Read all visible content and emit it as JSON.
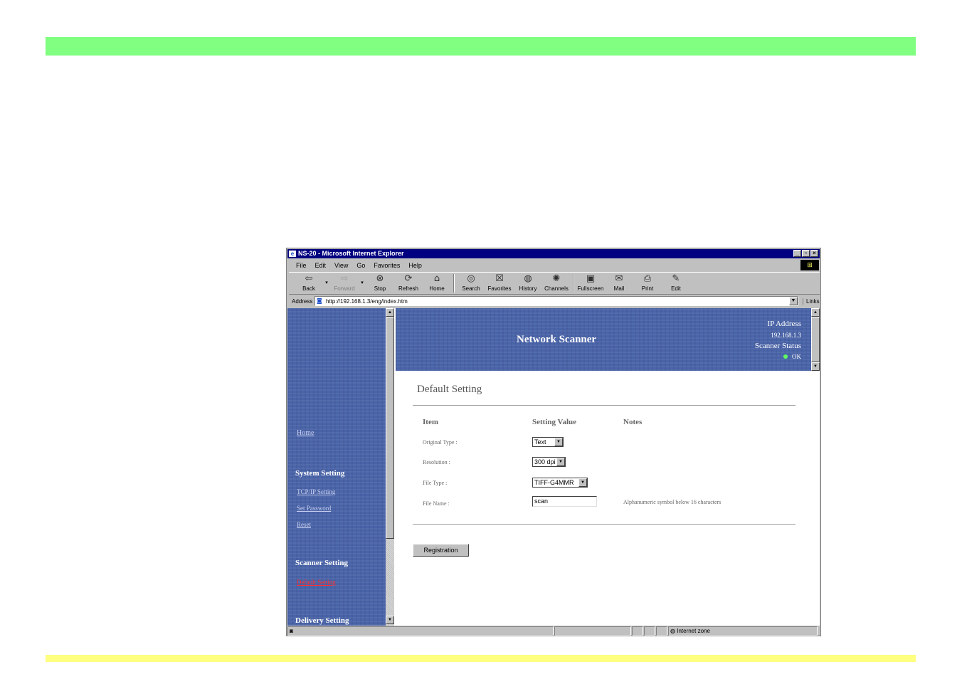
{
  "browser": {
    "title": "NS-20 - Microsoft Internet Explorer",
    "menu": [
      "File",
      "Edit",
      "View",
      "Go",
      "Favorites",
      "Help"
    ],
    "toolbar": [
      {
        "label": "Back",
        "icon": "back-arrow-icon",
        "glyph": "⇦"
      },
      {
        "label": "Forward",
        "icon": "forward-arrow-icon",
        "glyph": "⇨"
      },
      {
        "label": "Stop",
        "icon": "stop-icon",
        "glyph": "⊗"
      },
      {
        "label": "Refresh",
        "icon": "refresh-icon",
        "glyph": "⟳"
      },
      {
        "label": "Home",
        "icon": "home-icon",
        "glyph": "⌂"
      },
      {
        "label": "Search",
        "icon": "search-icon",
        "glyph": "◎"
      },
      {
        "label": "Favorites",
        "icon": "favorites-icon",
        "glyph": "☒"
      },
      {
        "label": "History",
        "icon": "history-icon",
        "glyph": "◍"
      },
      {
        "label": "Channels",
        "icon": "channels-icon",
        "glyph": "✺"
      },
      {
        "label": "Fullscreen",
        "icon": "fullscreen-icon",
        "glyph": "▣"
      },
      {
        "label": "Mail",
        "icon": "mail-icon",
        "glyph": "✉"
      },
      {
        "label": "Print",
        "icon": "print-icon",
        "glyph": "⎙"
      },
      {
        "label": "Edit",
        "icon": "edit-icon",
        "glyph": "✎"
      }
    ],
    "address_label": "Address",
    "address": "http://192.168.1.3/eng/index.htm",
    "links_label": "Links",
    "status_zone": "Internet zone"
  },
  "sidebar": {
    "home": "Home",
    "system_heading": "System Setting",
    "system_items": [
      "TCP/IP Setting",
      "Set Password",
      "Reset"
    ],
    "scanner_heading": "Scanner Setting",
    "scanner_items": [
      "Default Setting"
    ],
    "delivery_heading": "Delivery Setting"
  },
  "header": {
    "title": "Network Scanner",
    "ip_label": "IP Address",
    "ip_value": "192.168.1.3",
    "status_label": "Scanner Status",
    "status_value": "OK"
  },
  "main": {
    "page_title": "Default Setting",
    "columns": [
      "Item",
      "Setting Value",
      "Notes"
    ],
    "rows": [
      {
        "label": "Original Type :",
        "value": "Text"
      },
      {
        "label": "Resolution :",
        "value": "300 dpi"
      },
      {
        "label": "File Type :",
        "value": "TIFF-G4MMR"
      },
      {
        "label": "File Name :",
        "value": "scan",
        "note": "Alphanumeric symbol below 16 characters"
      }
    ],
    "register_button": "Registration"
  },
  "colors": {
    "top_band": "#80ff80",
    "bottom_band": "#ffff80",
    "frame_blue": "#4a64a8",
    "titlebar": "#000080"
  }
}
